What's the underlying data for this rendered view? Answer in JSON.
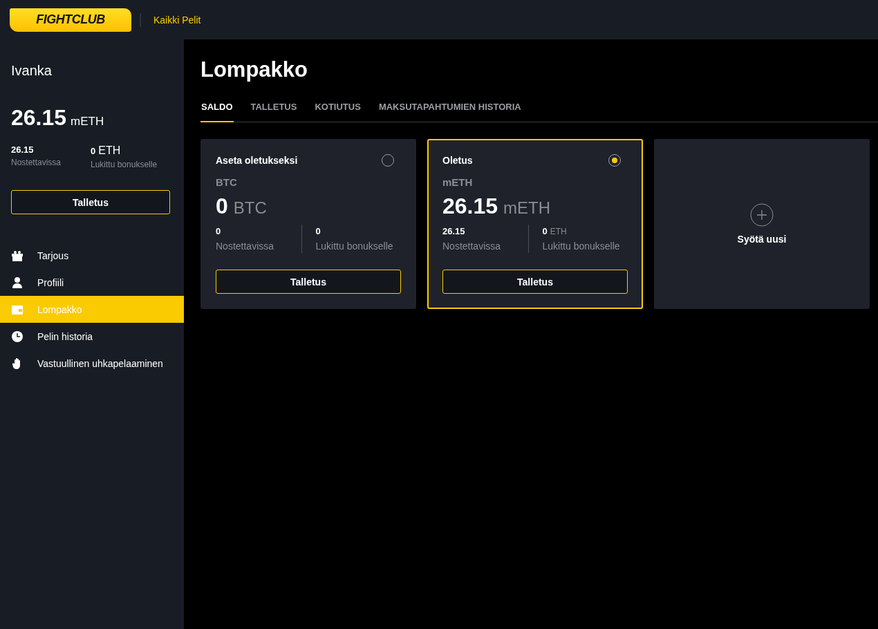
{
  "header": {
    "logo": "FIGHTCLUB",
    "link": "Kaikki Pelit"
  },
  "sidebar": {
    "user": "Ivanka",
    "balance": {
      "amount": "26.15",
      "unit": "mETH"
    },
    "stats": [
      {
        "value": "26.15",
        "label": "Nostettavissa"
      },
      {
        "value": "0",
        "unit": "ETH",
        "label": "Lukittu bonukselle"
      }
    ],
    "button": "Talletus",
    "items": [
      {
        "kind": "gift",
        "label": "Tarjous",
        "selected": false
      },
      {
        "kind": "user",
        "label": "Profiili",
        "selected": false
      },
      {
        "kind": "wallet",
        "label": "Lompakko",
        "selected": true
      },
      {
        "kind": "clock",
        "label": "Pelin historia",
        "selected": false
      },
      {
        "kind": "hand",
        "label": "Vastuullinen uhkapelaaminen",
        "selected": false
      }
    ]
  },
  "main": {
    "title": "Lompakko",
    "tabs": [
      {
        "label": "SALDO",
        "selected": true
      },
      {
        "label": "TALLETUS",
        "selected": false
      },
      {
        "label": "KOTIUTUS",
        "selected": false
      },
      {
        "label": "MAKSUTAPAHTUMIEN HISTORIA",
        "selected": false
      }
    ],
    "wallets": [
      {
        "heading": "Aseta oletukseksi",
        "selected": false,
        "currency": "BTC",
        "amount": "0",
        "unit": "BTC",
        "stats": [
          {
            "value": "0",
            "label": "Nostettavissa"
          },
          {
            "value": "0",
            "label": "Lukittu bonukselle"
          }
        ],
        "button": "Talletus"
      },
      {
        "heading": "Oletus",
        "selected": true,
        "currency": "mETH",
        "amount": "26.15",
        "unit": "mETH",
        "stats": [
          {
            "value": "26.15",
            "label": "Nostettavissa"
          },
          {
            "value": "0",
            "unit": "ETH",
            "label": "Lukittu bonukselle"
          }
        ],
        "button": "Talletus"
      }
    ],
    "add": {
      "label": "Syötä uusi"
    }
  }
}
